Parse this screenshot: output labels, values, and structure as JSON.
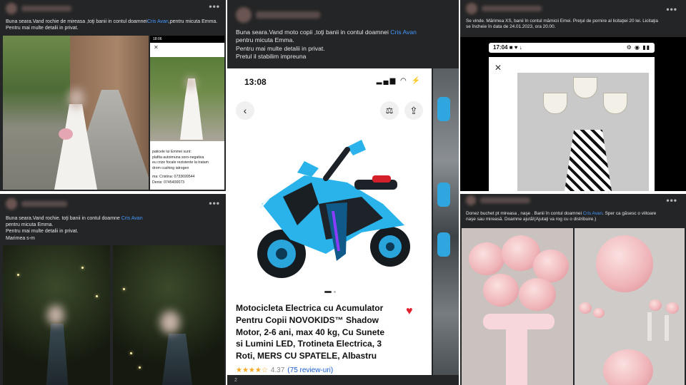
{
  "posts": [
    {
      "id": "dress",
      "menu": "•••",
      "text_before": "Buna seara.Vand rochie de mireasa ,toţi banii in contul doamnei",
      "mention": "Cris Avan",
      "text_after": ",pentru micuta Emma.",
      "line2": "Pentru mai multe detalii in privat.",
      "screenshot": {
        "time": "18:06",
        "close": "✕",
        "doc_lines": [
          "paticele lui Emmei sunt:",
          "plafita autoimuna soro-negativa",
          "eu crize focale rezistente la tratam",
          "drom cushing iatrogen",
          "",
          "ma: Cristina: 0733699544",
          "Denis: 0745400073"
        ]
      }
    },
    {
      "id": "evening",
      "menu": "•••",
      "text_before": "Buna seara.Vand rochie. toţi banii in contul doamne",
      "mention": "Cris Avan",
      "lines": [
        "pentru micuta Emma.",
        "Pentru mai multe detalii in privat.",
        "Marimea s-m"
      ]
    },
    {
      "id": "moto",
      "text_before": "Buna seara.Vand moto copii ,toţi banii in contul doamnei",
      "mention": "Cris Avan",
      "lines": [
        "pentru micuta Emma.",
        "Pentru mai multe detalii in privat.",
        "Pretul il stabilim impreuna"
      ],
      "app": {
        "time": "13:08",
        "status_icons": "▂▄▆ ◠ ⚡",
        "back_icon": "‹",
        "compare_icon": "⚖",
        "share_icon": "⇪",
        "title_lines": [
          "Motocicleta Electrica cu Acumulator",
          "Pentru Copii NOVOKIDS™ Shadow",
          "Motor, 2-6 ani, max 40 kg, Cu Sunete",
          "si Lumini LED, Trotineta Electrica, 3",
          "Roti, MERS CU SPATELE, Albastru"
        ],
        "stars": "★★★★☆",
        "score": "4.37",
        "reviews": "(75 review-uri)",
        "heart": "♥"
      },
      "footer": "2"
    },
    {
      "id": "auction",
      "menu": "•••",
      "text_before": "Se vinde. Mărimea XS, banii  în contul mămicii Emei. Preţul de pornire al licitaţiei 20 lei. Licitaţia",
      "line2": "se încheie în data de 24.01.2023, ora 20.00.",
      "phone": {
        "time": "17:04",
        "status_left_icons": "■ ♥ ↓",
        "status_right_icons": "⚙ ◉ ▮▮",
        "close": "✕"
      }
    },
    {
      "id": "bouquet",
      "menu": "•••",
      "text_before": "Donez buchet pt mireasa , naşe . Banii în contul doamnei",
      "mention": "Cris Avan",
      "text_after": ". Sper ca găsesc o viitoare",
      "line2": "naşe sau mireasă.  Doamne ajută!(Ajutaţi va rog cu o distribuire.)"
    }
  ],
  "colors": {
    "post_bg": "#242526",
    "text": "#e4e6eb",
    "mention": "#4599ff",
    "heart": "#e0202a",
    "star": "#f5a623"
  }
}
